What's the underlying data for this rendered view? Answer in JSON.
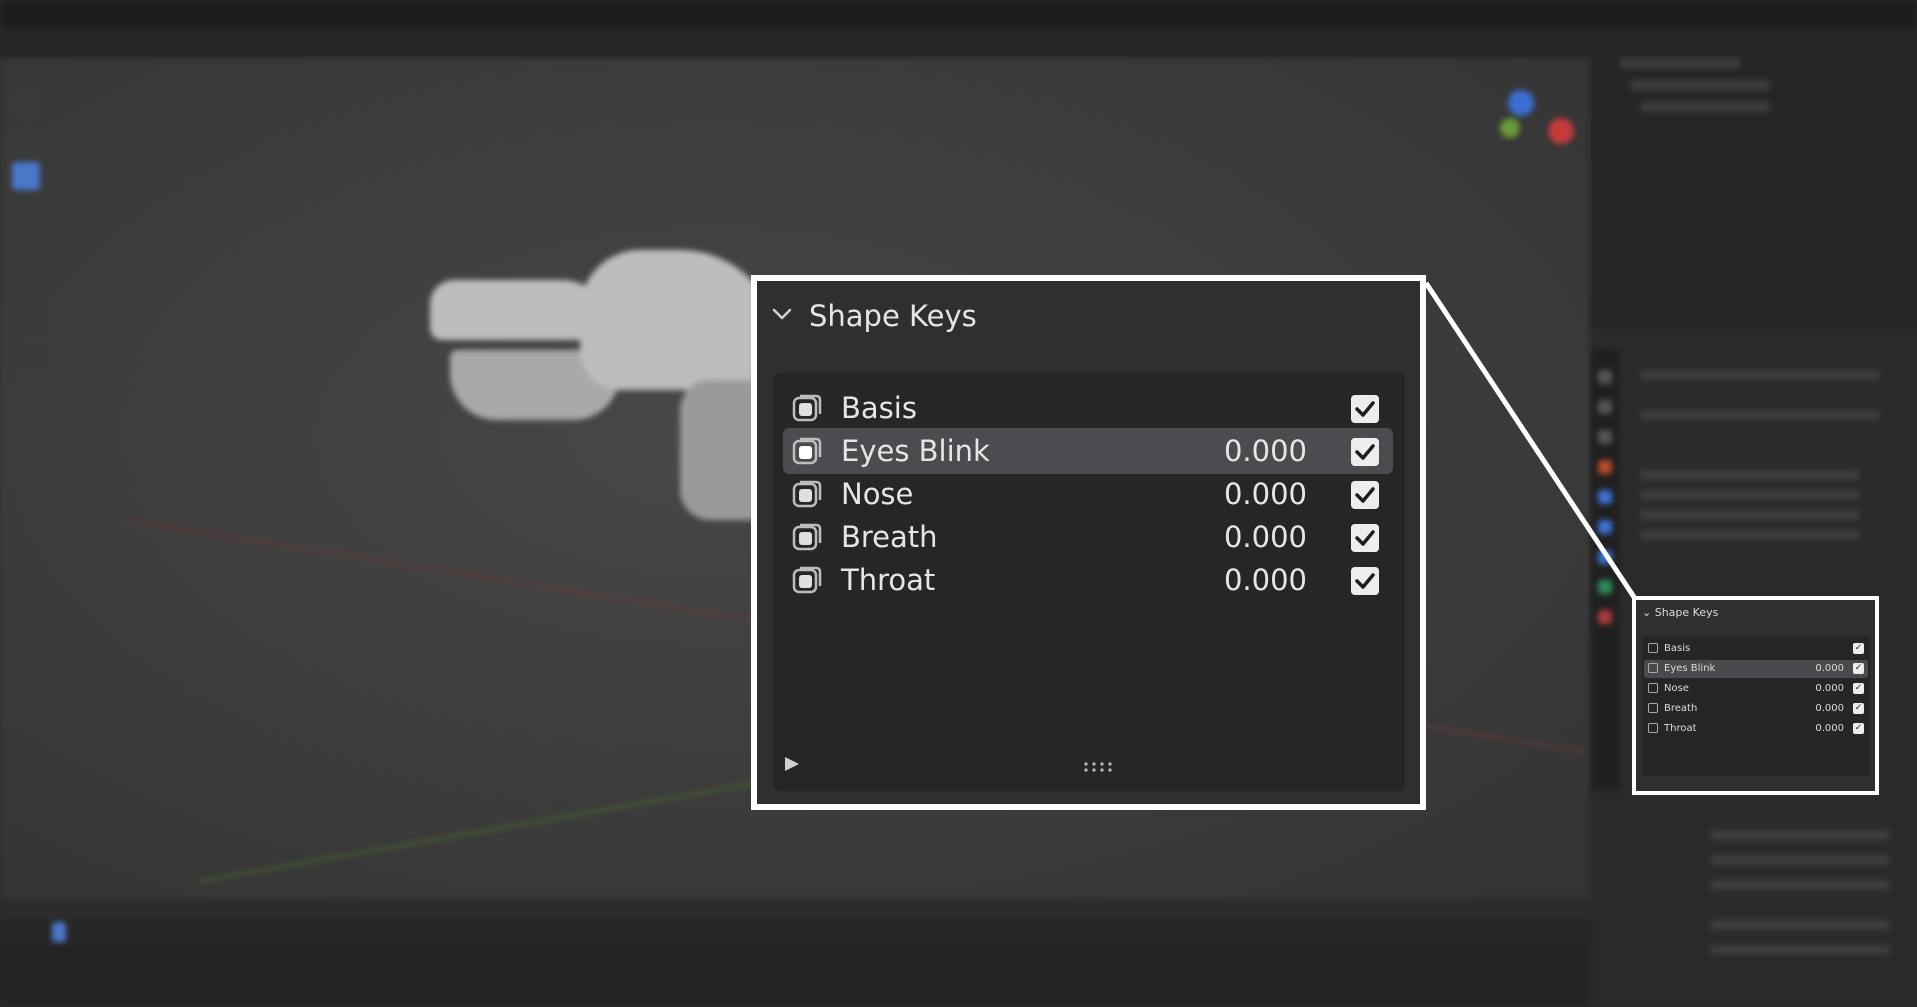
{
  "panel": {
    "title": "Shape Keys",
    "collapse_icon": "chevron-down-icon",
    "expand_icon": "play-triangle-icon",
    "drag_handle_icon": "drag-dots-icon"
  },
  "shape_keys": [
    {
      "name": "Basis",
      "value": "",
      "enabled": true,
      "selected": false,
      "icon": "shape-key-icon"
    },
    {
      "name": "Eyes Blink",
      "value": "0.000",
      "enabled": true,
      "selected": true,
      "icon": "shape-key-icon"
    },
    {
      "name": "Nose",
      "value": "0.000",
      "enabled": true,
      "selected": false,
      "icon": "shape-key-icon"
    },
    {
      "name": "Breath",
      "value": "0.000",
      "enabled": true,
      "selected": false,
      "icon": "shape-key-icon"
    },
    {
      "name": "Throat",
      "value": "0.000",
      "enabled": true,
      "selected": false,
      "icon": "shape-key-icon"
    }
  ],
  "colors": {
    "highlight_border": "#ffffff",
    "panel_bg": "#2f2f2f",
    "list_bg": "#262626",
    "selected_row": "#4b4b50",
    "accent_blue": "#4a77c9"
  }
}
